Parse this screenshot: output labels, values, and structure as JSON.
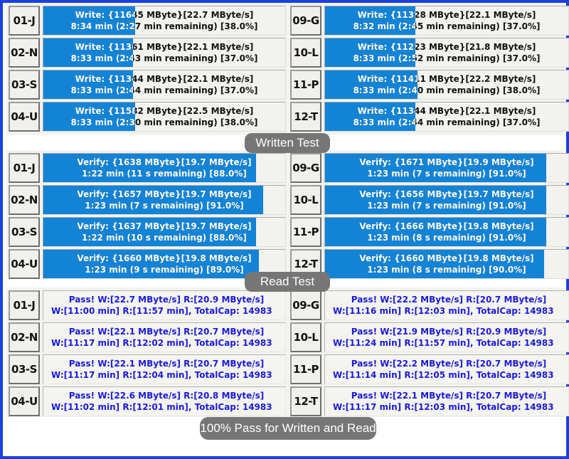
{
  "colors": {
    "frame_blue": "#1c3fe0",
    "bar_fill_blue": "#1383d6",
    "pass_text_blue": "#1a1ae0",
    "pill_gray": "#767676",
    "panel_bg": "#f3f3f0"
  },
  "status_pills": {
    "written": "Written Test",
    "read": "Read Test",
    "total": "100% Pass for Written and Read"
  },
  "write_section": {
    "left": [
      {
        "id": "01-J",
        "line1": "Write: {11645 MByte}[22.7 MByte/s]",
        "line2": "8:34 min (2:27 min remaining)   [38.0%]",
        "percent": 38.0
      },
      {
        "id": "02-N",
        "line1": "Write: {11361 MByte}[22.1 MByte/s]",
        "line2": "8:33 min (2:43 min remaining)   [37.0%]",
        "percent": 37.0
      },
      {
        "id": "03-S",
        "line1": "Write: {11344 MByte}[22.1 MByte/s]",
        "line2": "8:33 min (2:44 min remaining)   [37.0%]",
        "percent": 37.0
      },
      {
        "id": "04-U",
        "line1": "Write: {11582 MByte}[22.5 MByte/s]",
        "line2": "8:33 min (2:30 min remaining)   [38.0%]",
        "percent": 38.0
      }
    ],
    "right": [
      {
        "id": "09-G",
        "line1": "Write: {11328 MByte}[22.1 MByte/s]",
        "line2": "8:32 min (2:45 min remaining)   [37.0%]",
        "percent": 37.0
      },
      {
        "id": "10-L",
        "line1": "Write: {11223 MByte}[21.8 MByte/s]",
        "line2": "8:33 min (2:52 min remaining)   [37.0%]",
        "percent": 37.0
      },
      {
        "id": "11-P",
        "line1": "Write: {11411 MByte}[22.2 MByte/s]",
        "line2": "8:33 min (2:40 min remaining)   [38.0%]",
        "percent": 38.0
      },
      {
        "id": "12-T",
        "line1": "Write: {11344 MByte}[22.1 MByte/s]",
        "line2": "8:33 min (2:44 min remaining)   [37.0%]",
        "percent": 37.0
      }
    ]
  },
  "read_section": {
    "left": [
      {
        "id": "01-J",
        "line1": "Verify: {1638 MByte}[19.7 MByte/s]",
        "line2": "1:22 min (11 s remaining)   [88.0%]",
        "percent": 88.0
      },
      {
        "id": "02-N",
        "line1": "Verify: {1657 MByte}[19.7 MByte/s]",
        "line2": "1:23 min (7 s remaining)   [91.0%]",
        "percent": 91.0
      },
      {
        "id": "03-S",
        "line1": "Verify: {1637 MByte}[19.7 MByte/s]",
        "line2": "1:22 min (10 s remaining)   [88.0%]",
        "percent": 88.0
      },
      {
        "id": "04-U",
        "line1": "Verify: {1660 MByte}[19.8 MByte/s]",
        "line2": "1:23 min (9 s remaining)   [89.0%]",
        "percent": 89.0
      }
    ],
    "right": [
      {
        "id": "09-G",
        "line1": "Verify: {1671 MByte}[19.9 MByte/s]",
        "line2": "1:23 min (7 s remaining)   [91.0%]",
        "percent": 91.0
      },
      {
        "id": "10-L",
        "line1": "Verify: {1656 MByte}[19.7 MByte/s]",
        "line2": "1:23 min (7 s remaining)   [91.0%]",
        "percent": 91.0
      },
      {
        "id": "11-P",
        "line1": "Verify: {1666 MByte}[19.8 MByte/s]",
        "line2": "1:23 min (8 s remaining)   [91.0%]",
        "percent": 91.0
      },
      {
        "id": "12-T",
        "line1": "Verify: {1660 MByte}[19.8 MByte/s]",
        "line2": "1:23 min (8 s remaining)   [90.0%]",
        "percent": 90.0
      }
    ]
  },
  "pass_section": {
    "left": [
      {
        "id": "01-J",
        "line1": "Pass! W:[22.7 MByte/s] R:[20.9 MByte/s]",
        "line2": ": W:[11:00 min] R:[11:57 min], TotalCap: 14983"
      },
      {
        "id": "02-N",
        "line1": "Pass! W:[22.1 MByte/s] R:[20.7 MByte/s]",
        "line2": ": W:[11:17 min] R:[12:02 min], TotalCap: 14983"
      },
      {
        "id": "03-S",
        "line1": "Pass! W:[22.1 MByte/s] R:[20.7 MByte/s]",
        "line2": ": W:[11:17 min] R:[12:04 min], TotalCap: 14983"
      },
      {
        "id": "04-U",
        "line1": "Pass! W:[22.6 MByte/s] R:[20.8 MByte/s]",
        "line2": ": W:[11:02 min] R:[12:01 min], TotalCap: 14983"
      }
    ],
    "right": [
      {
        "id": "09-G",
        "line1": "Pass! W:[22.2 MByte/s] R:[20.7 MByte/s]",
        "line2": ": W:[11:16 min] R:[12:03 min], TotalCap: 14983"
      },
      {
        "id": "10-L",
        "line1": "Pass! W:[21.9 MByte/s] R:[20.9 MByte/s]",
        "line2": ": W:[11:24 min] R:[11:57 min], TotalCap: 14983"
      },
      {
        "id": "11-P",
        "line1": "Pass! W:[22.2 MByte/s] R:[20.7 MByte/s]",
        "line2": ": W:[11:14 min] R:[12:05 min], TotalCap: 14983"
      },
      {
        "id": "12-T",
        "line1": "Pass! W:[22.1 MByte/s] R:[20.7 MByte/s]",
        "line2": ": W:[11:17 min] R:[12:03 min], TotalCap: 14983"
      }
    ]
  }
}
